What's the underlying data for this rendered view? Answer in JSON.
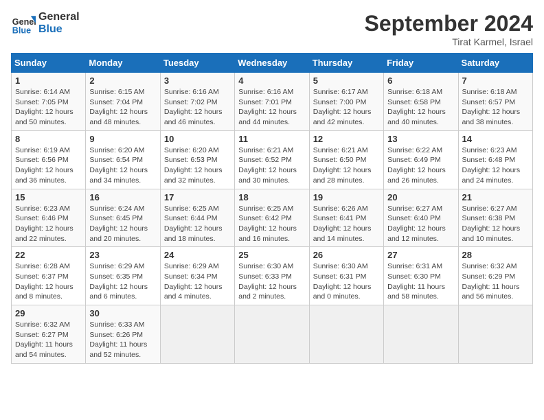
{
  "header": {
    "logo_line1": "General",
    "logo_line2": "Blue",
    "month": "September 2024",
    "location": "Tirat Karmel, Israel"
  },
  "weekdays": [
    "Sunday",
    "Monday",
    "Tuesday",
    "Wednesday",
    "Thursday",
    "Friday",
    "Saturday"
  ],
  "weeks": [
    [
      {
        "day": "1",
        "info": "Sunrise: 6:14 AM\nSunset: 7:05 PM\nDaylight: 12 hours\nand 50 minutes."
      },
      {
        "day": "2",
        "info": "Sunrise: 6:15 AM\nSunset: 7:04 PM\nDaylight: 12 hours\nand 48 minutes."
      },
      {
        "day": "3",
        "info": "Sunrise: 6:16 AM\nSunset: 7:02 PM\nDaylight: 12 hours\nand 46 minutes."
      },
      {
        "day": "4",
        "info": "Sunrise: 6:16 AM\nSunset: 7:01 PM\nDaylight: 12 hours\nand 44 minutes."
      },
      {
        "day": "5",
        "info": "Sunrise: 6:17 AM\nSunset: 7:00 PM\nDaylight: 12 hours\nand 42 minutes."
      },
      {
        "day": "6",
        "info": "Sunrise: 6:18 AM\nSunset: 6:58 PM\nDaylight: 12 hours\nand 40 minutes."
      },
      {
        "day": "7",
        "info": "Sunrise: 6:18 AM\nSunset: 6:57 PM\nDaylight: 12 hours\nand 38 minutes."
      }
    ],
    [
      {
        "day": "8",
        "info": "Sunrise: 6:19 AM\nSunset: 6:56 PM\nDaylight: 12 hours\nand 36 minutes."
      },
      {
        "day": "9",
        "info": "Sunrise: 6:20 AM\nSunset: 6:54 PM\nDaylight: 12 hours\nand 34 minutes."
      },
      {
        "day": "10",
        "info": "Sunrise: 6:20 AM\nSunset: 6:53 PM\nDaylight: 12 hours\nand 32 minutes."
      },
      {
        "day": "11",
        "info": "Sunrise: 6:21 AM\nSunset: 6:52 PM\nDaylight: 12 hours\nand 30 minutes."
      },
      {
        "day": "12",
        "info": "Sunrise: 6:21 AM\nSunset: 6:50 PM\nDaylight: 12 hours\nand 28 minutes."
      },
      {
        "day": "13",
        "info": "Sunrise: 6:22 AM\nSunset: 6:49 PM\nDaylight: 12 hours\nand 26 minutes."
      },
      {
        "day": "14",
        "info": "Sunrise: 6:23 AM\nSunset: 6:48 PM\nDaylight: 12 hours\nand 24 minutes."
      }
    ],
    [
      {
        "day": "15",
        "info": "Sunrise: 6:23 AM\nSunset: 6:46 PM\nDaylight: 12 hours\nand 22 minutes."
      },
      {
        "day": "16",
        "info": "Sunrise: 6:24 AM\nSunset: 6:45 PM\nDaylight: 12 hours\nand 20 minutes."
      },
      {
        "day": "17",
        "info": "Sunrise: 6:25 AM\nSunset: 6:44 PM\nDaylight: 12 hours\nand 18 minutes."
      },
      {
        "day": "18",
        "info": "Sunrise: 6:25 AM\nSunset: 6:42 PM\nDaylight: 12 hours\nand 16 minutes."
      },
      {
        "day": "19",
        "info": "Sunrise: 6:26 AM\nSunset: 6:41 PM\nDaylight: 12 hours\nand 14 minutes."
      },
      {
        "day": "20",
        "info": "Sunrise: 6:27 AM\nSunset: 6:40 PM\nDaylight: 12 hours\nand 12 minutes."
      },
      {
        "day": "21",
        "info": "Sunrise: 6:27 AM\nSunset: 6:38 PM\nDaylight: 12 hours\nand 10 minutes."
      }
    ],
    [
      {
        "day": "22",
        "info": "Sunrise: 6:28 AM\nSunset: 6:37 PM\nDaylight: 12 hours\nand 8 minutes."
      },
      {
        "day": "23",
        "info": "Sunrise: 6:29 AM\nSunset: 6:35 PM\nDaylight: 12 hours\nand 6 minutes."
      },
      {
        "day": "24",
        "info": "Sunrise: 6:29 AM\nSunset: 6:34 PM\nDaylight: 12 hours\nand 4 minutes."
      },
      {
        "day": "25",
        "info": "Sunrise: 6:30 AM\nSunset: 6:33 PM\nDaylight: 12 hours\nand 2 minutes."
      },
      {
        "day": "26",
        "info": "Sunrise: 6:30 AM\nSunset: 6:31 PM\nDaylight: 12 hours\nand 0 minutes."
      },
      {
        "day": "27",
        "info": "Sunrise: 6:31 AM\nSunset: 6:30 PM\nDaylight: 11 hours\nand 58 minutes."
      },
      {
        "day": "28",
        "info": "Sunrise: 6:32 AM\nSunset: 6:29 PM\nDaylight: 11 hours\nand 56 minutes."
      }
    ],
    [
      {
        "day": "29",
        "info": "Sunrise: 6:32 AM\nSunset: 6:27 PM\nDaylight: 11 hours\nand 54 minutes."
      },
      {
        "day": "30",
        "info": "Sunrise: 6:33 AM\nSunset: 6:26 PM\nDaylight: 11 hours\nand 52 minutes."
      },
      {
        "day": "",
        "info": ""
      },
      {
        "day": "",
        "info": ""
      },
      {
        "day": "",
        "info": ""
      },
      {
        "day": "",
        "info": ""
      },
      {
        "day": "",
        "info": ""
      }
    ]
  ]
}
